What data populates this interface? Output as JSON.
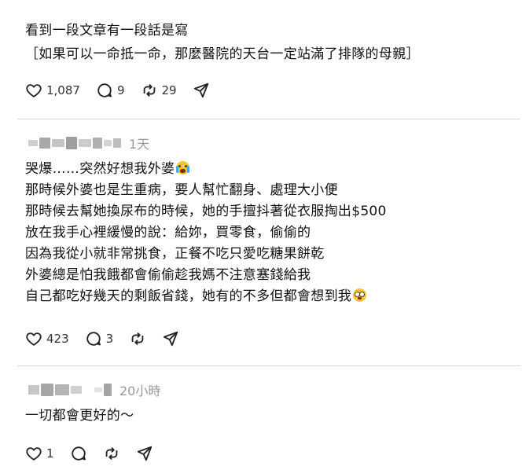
{
  "post1": {
    "lines": [
      "看到一段文章有一段話是寫",
      "［如果可以一命抵一命，那麼醫院的天台一定站滿了排隊的母親］"
    ],
    "likes": "1,087",
    "comments": "9",
    "reposts": "29"
  },
  "reply1": {
    "time": "1天",
    "lines": [
      "哭爆……突然好想我外婆",
      "那時候外婆也是生重病，要人幫忙翻身、處理大小便",
      "那時候去幫她換尿布的時候，她的手擅抖著從衣服掏出$500",
      "放在我手心裡緩慢的說：給妳，買零食，偷偷的",
      "因為我從小就非常挑食，正餐不吃只愛吃糖果餅乾",
      "外婆總是怕我餓都會偷偷趁我媽不注意塞錢給我",
      "自己都吃好幾天的剩飯省錢，她有的不多但都會想到我"
    ],
    "emoji_line1": "crying-face-emoji",
    "emoji_line7": "teary-pleading-face-emoji",
    "likes": "423",
    "comments": "3"
  },
  "reply2": {
    "time": "20小時",
    "lines": [
      "一切都會更好的～"
    ],
    "likes": "1"
  },
  "icons": [
    "heart-icon",
    "comment-icon",
    "repost-icon",
    "share-icon"
  ],
  "colors": {
    "text": "#111111",
    "muted": "#9a9a9a",
    "separator": "#d9d9d9"
  }
}
